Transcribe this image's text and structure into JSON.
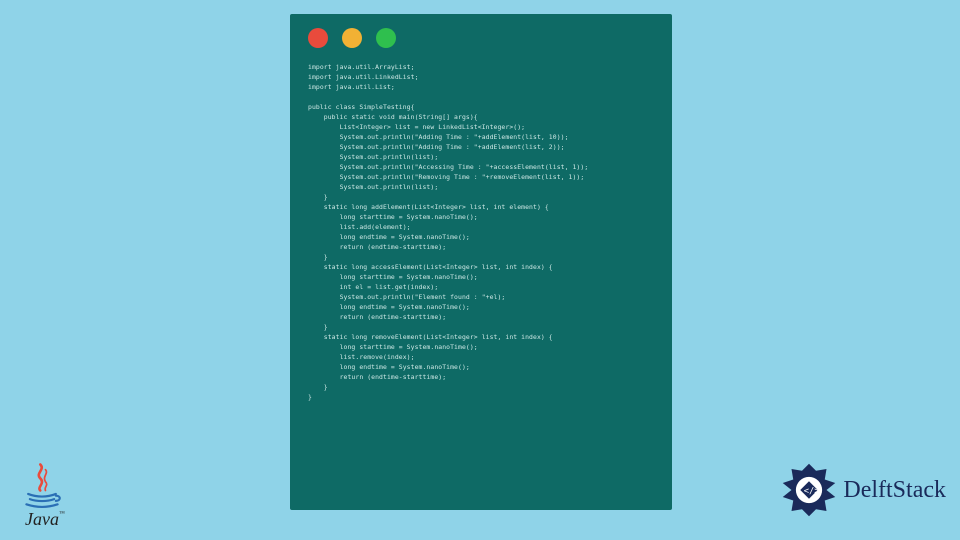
{
  "colors": {
    "background": "#8fd3e8",
    "window": "#0e6a65",
    "code": "#cfe9e6",
    "dotRed": "#e94b3c",
    "dotYellow": "#f2b134",
    "dotGreen": "#2fbf4e",
    "delftBlue": "#1a2a5a"
  },
  "java_logo_text": "Java",
  "java_tm": "™",
  "delft_text": "DelftStack",
  "code_lines": [
    "import java.util.ArrayList;",
    "import java.util.LinkedList;",
    "import java.util.List;",
    "",
    "public class SimpleTesting{",
    "    public static void main(String[] args){",
    "        List<Integer> list = new LinkedList<Integer>();",
    "        System.out.println(\"Adding Time : \"+addElement(list, 10));",
    "        System.out.println(\"Adding Time : \"+addElement(list, 2));",
    "        System.out.println(list);",
    "        System.out.println(\"Accessing Time : \"+accessElement(list, 1));",
    "        System.out.println(\"Removing Time : \"+removeElement(list, 1));",
    "        System.out.println(list);",
    "    }",
    "    static long addElement(List<Integer> list, int element) {",
    "        long starttime = System.nanoTime();",
    "        list.add(element);",
    "        long endtime = System.nanoTime();",
    "        return (endtime-starttime);",
    "    }",
    "    static long accessElement(List<Integer> list, int index) {",
    "        long starttime = System.nanoTime();",
    "        int el = list.get(index);",
    "        System.out.println(\"Element found : \"+el);",
    "        long endtime = System.nanoTime();",
    "        return (endtime-starttime);",
    "    }",
    "    static long removeElement(List<Integer> list, int index) {",
    "        long starttime = System.nanoTime();",
    "        list.remove(index);",
    "        long endtime = System.nanoTime();",
    "        return (endtime-starttime);",
    "    }",
    "}"
  ]
}
